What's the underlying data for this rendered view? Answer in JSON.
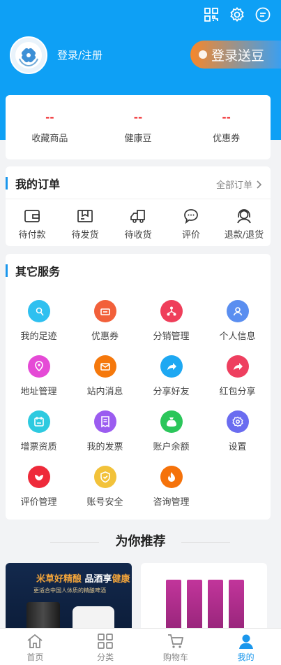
{
  "header": {
    "login_text": "登录/注册",
    "promo_label": "登录送豆",
    "icons": [
      "qrcode-icon",
      "gear-icon",
      "message-icon"
    ],
    "background_color": "#0ea0f5"
  },
  "stats": [
    {
      "value": "--",
      "label": "收藏商品"
    },
    {
      "value": "--",
      "label": "健康豆"
    },
    {
      "value": "--",
      "label": "优惠券"
    }
  ],
  "orders": {
    "title": "我的订单",
    "all_label": "全部订单",
    "items": [
      {
        "label": "待付款",
        "icon": "wallet-icon"
      },
      {
        "label": "待发货",
        "icon": "package-icon"
      },
      {
        "label": "待收货",
        "icon": "truck-icon"
      },
      {
        "label": "评价",
        "icon": "comment-icon"
      },
      {
        "label": "退款/退货",
        "icon": "customer-service-icon"
      }
    ]
  },
  "services": {
    "title": "其它服务",
    "items": [
      {
        "label": "我的足迹",
        "icon": "footprint-icon",
        "color": "#2fc0f0"
      },
      {
        "label": "优惠券",
        "icon": "coupon-icon",
        "color": "#f2603a"
      },
      {
        "label": "分销管理",
        "icon": "network-icon",
        "color": "#ef3e5a"
      },
      {
        "label": "个人信息",
        "icon": "user-icon",
        "color": "#5a8ef0"
      },
      {
        "label": "地址管理",
        "icon": "location-icon",
        "color": "#e54ad6"
      },
      {
        "label": "站内消息",
        "icon": "mail-icon",
        "color": "#f5780c"
      },
      {
        "label": "分享好友",
        "icon": "share-icon",
        "color": "#1ea8f2"
      },
      {
        "label": "红包分享",
        "icon": "redpacket-share-icon",
        "color": "#ee3f5f"
      },
      {
        "label": "增票资质",
        "icon": "invoice-qualification-icon",
        "color": "#2ecae0"
      },
      {
        "label": "我的发票",
        "icon": "receipt-icon",
        "color": "#9b5cf0"
      },
      {
        "label": "账户余额",
        "icon": "money-bag-icon",
        "color": "#2bc65a"
      },
      {
        "label": "设置",
        "icon": "settings-icon",
        "color": "#6a6cf0"
      },
      {
        "label": "评价管理",
        "icon": "flower-icon",
        "color": "#ee2a3a"
      },
      {
        "label": "账号安全",
        "icon": "shield-icon",
        "color": "#f2c23a"
      },
      {
        "label": "咨询管理",
        "icon": "flame-icon",
        "color": "#f5720a"
      }
    ]
  },
  "recommend": {
    "title": "为你推荐",
    "product1": {
      "headline_a": "米草好精酿",
      "headline_b": " 品酒享",
      "headline_c": "健康",
      "subtitle": "更适合中国人体质的精酿啤酒"
    }
  },
  "tabbar": [
    {
      "label": "首页",
      "icon": "home-icon"
    },
    {
      "label": "分类",
      "icon": "category-icon"
    },
    {
      "label": "购物车",
      "icon": "cart-icon"
    },
    {
      "label": "我的",
      "icon": "profile-icon"
    }
  ]
}
